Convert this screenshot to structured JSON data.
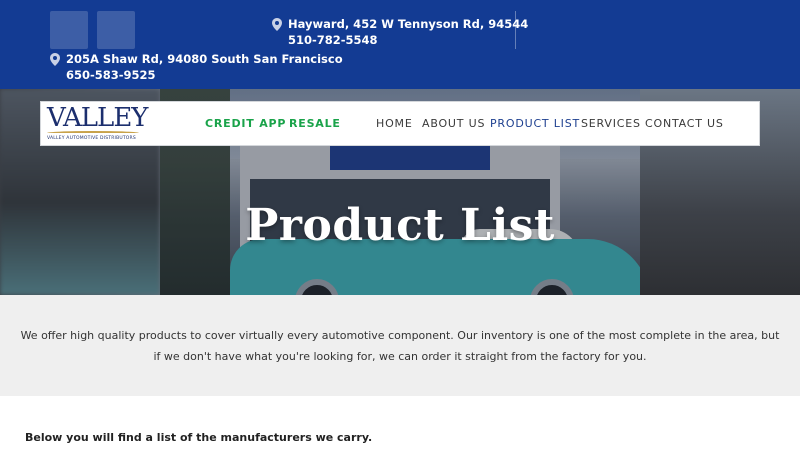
{
  "header": {
    "locations": [
      {
        "address": "Hayward, 452 W Tennyson Rd, 94544",
        "phone": "510-782-5548"
      },
      {
        "address": "205A Shaw Rd, 94080 South San Francisco",
        "phone": "650-583-9525"
      }
    ],
    "social_icons": [
      "social-icon",
      "social-icon"
    ]
  },
  "logo": {
    "word": "VALLEY",
    "subtitle": "VALLEY AUTOMOTIVE DISTRIBUTORS"
  },
  "nav": {
    "credit_app": "CREDIT APP",
    "resale": "RESALE",
    "home": "HOME",
    "about_us": "ABOUT US",
    "product_list": "PRODUCT LIST",
    "services": "SERVICES",
    "contact_us": "CONTACT US",
    "active_item": "PRODUCT LIST"
  },
  "hero": {
    "title": "Product List"
  },
  "intro": {
    "text": "We offer high quality products to cover virtually every automotive component. Our inventory is one of the most complete in the area, but if we don't have what you're looking for, we can order it straight from the factory for you."
  },
  "manufacturers": {
    "heading": "Below you will find a list of the manufacturers we carry."
  },
  "colors": {
    "header_blue": "#133b93",
    "accent_green": "#1aa34a",
    "active_blue": "#1d3f8f",
    "intro_bg": "#efefef"
  }
}
